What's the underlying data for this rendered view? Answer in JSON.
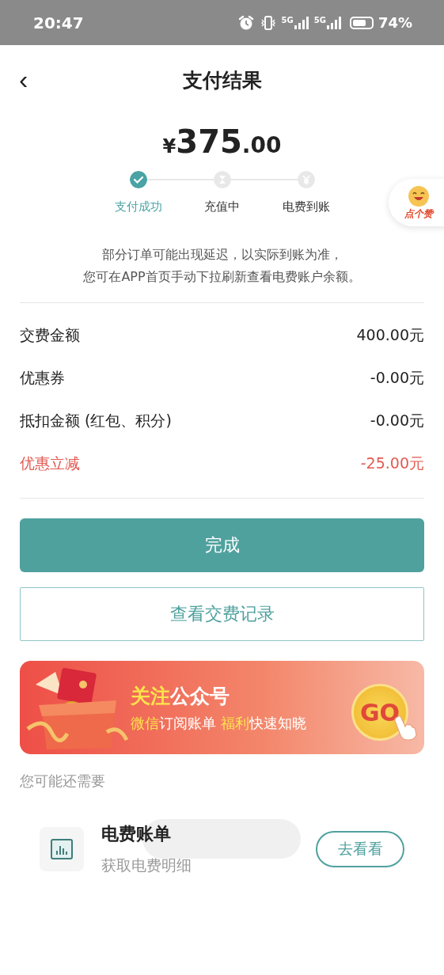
{
  "status_bar": {
    "time": "20:47",
    "network_1": "5G",
    "network_2": "5G",
    "battery": "74%"
  },
  "nav": {
    "back": "‹",
    "title": "支付结果"
  },
  "amount": {
    "currency": "¥",
    "integer": "375",
    "decimal": ".00"
  },
  "steps": [
    {
      "label": "支付成功",
      "done": true
    },
    {
      "label": "充值中",
      "done": false
    },
    {
      "label": "电费到账",
      "done": false
    }
  ],
  "like_badge": {
    "label": "点个赞"
  },
  "notice": [
    "部分订单可能出现延迟，以实际到账为准，",
    "您可在APP首页手动下拉刷新查看电费账户余额。"
  ],
  "fees": [
    {
      "label": "交费金额",
      "value": "400.00元",
      "highlight": false
    },
    {
      "label": "优惠券",
      "value": "-0.00元",
      "highlight": false
    },
    {
      "label": "抵扣金额 (红包、积分)",
      "value": "-0.00元",
      "highlight": false
    },
    {
      "label": "优惠立减",
      "value": "-25.00元",
      "highlight": true
    }
  ],
  "buttons": [
    {
      "label": "完成",
      "kind": "primary"
    },
    {
      "label": "查看交费记录",
      "kind": "outline"
    }
  ],
  "banner": {
    "title": [
      {
        "text": "关注",
        "highlight": true
      },
      {
        "text": "公众号",
        "highlight": false
      }
    ],
    "subtitle": [
      {
        "text": "微信",
        "highlight": true
      },
      {
        "text": "订阅账单",
        "highlight": false
      },
      {
        "text": " 福利",
        "highlight": true
      },
      {
        "text": "快速知晓",
        "highlight": false
      }
    ],
    "go": "GO"
  },
  "section_title": "您可能还需要",
  "suggestions": [
    {
      "title": "电费账单",
      "subtitle": "获取电费明细",
      "action": "去看看"
    }
  ]
}
